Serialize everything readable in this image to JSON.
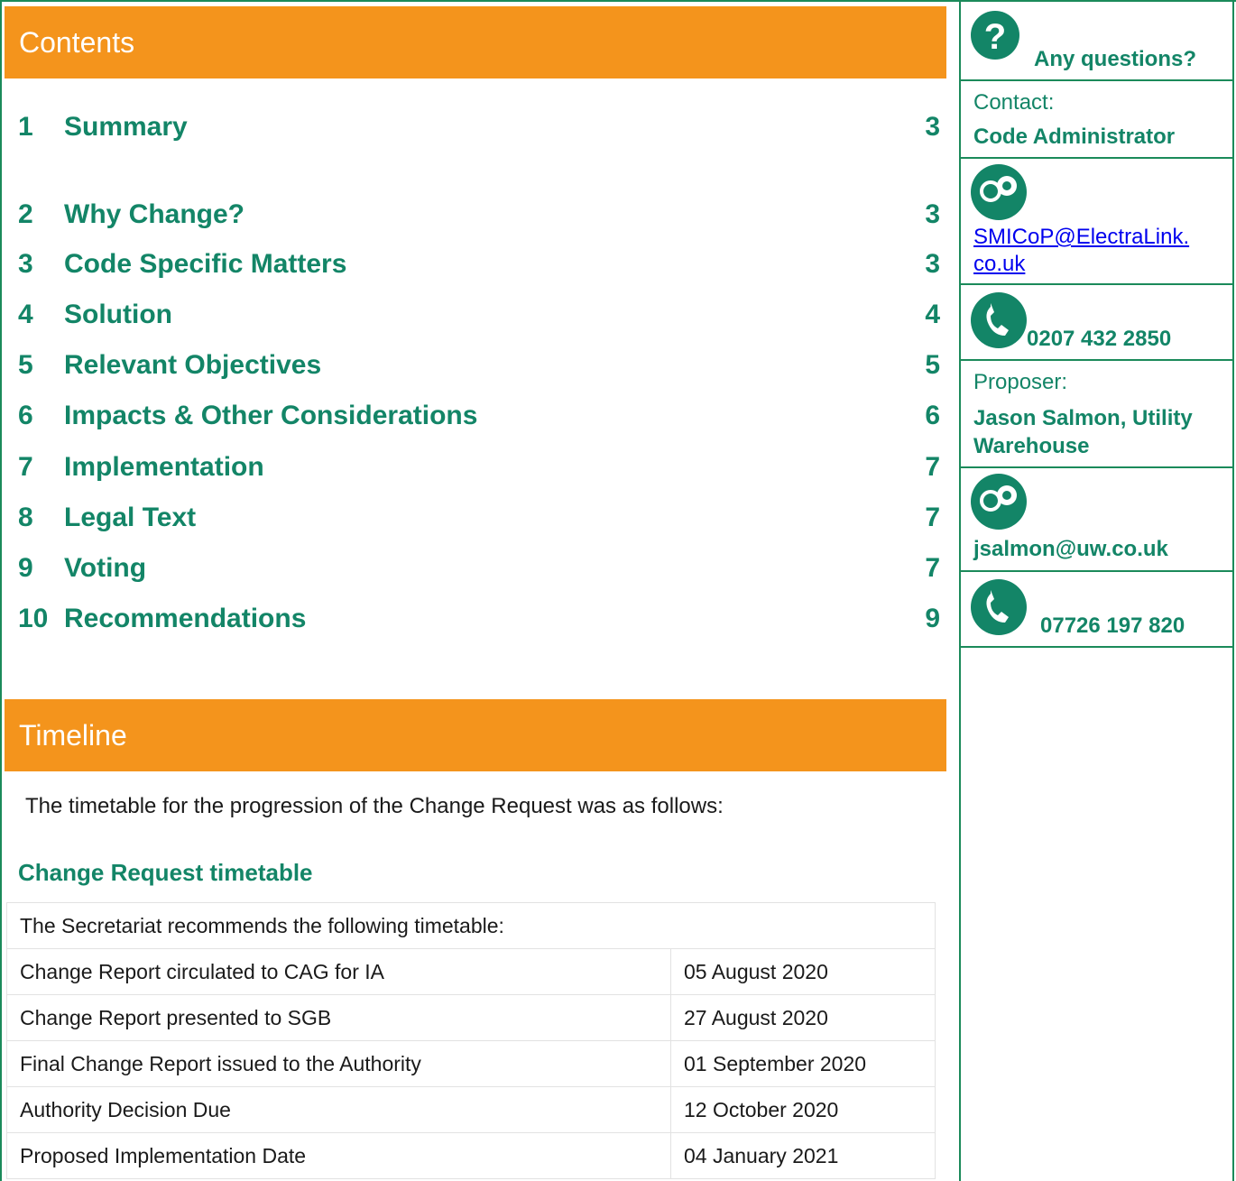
{
  "contents": {
    "title": "Contents",
    "items": [
      {
        "num": "1",
        "title": "Summary",
        "page": "3"
      },
      {
        "num": "2",
        "title": "Why Change?",
        "page": "3"
      },
      {
        "num": "3",
        "title": "Code Specific Matters",
        "page": "3"
      },
      {
        "num": "4",
        "title": "Solution",
        "page": "4"
      },
      {
        "num": "5",
        "title": "Relevant Objectives",
        "page": "5"
      },
      {
        "num": "6",
        "title": "Impacts & Other Considerations",
        "page": "6"
      },
      {
        "num": "7",
        "title": "Implementation",
        "page": "7"
      },
      {
        "num": "8",
        "title": "Legal Text",
        "page": "7"
      },
      {
        "num": "9",
        "title": "Voting",
        "page": "7"
      },
      {
        "num": "10",
        "title": "Recommendations",
        "page": "9"
      }
    ]
  },
  "timeline": {
    "title": "Timeline",
    "intro": "The timetable for the progression of the Change Request was as follows:",
    "subheading": "Change Request timetable",
    "table_header": "The Secretariat recommends the following timetable:",
    "rows": [
      {
        "event": "Change Report circulated to CAG for IA",
        "date": "05 August 2020"
      },
      {
        "event": "Change Report presented to SGB",
        "date": "27 August 2020"
      },
      {
        "event": "Final Change Report issued to the Authority",
        "date": "01 September 2020"
      },
      {
        "event": "Authority Decision Due",
        "date": "12 October 2020"
      },
      {
        "event": "Proposed Implementation Date",
        "date": "04 January 2021"
      }
    ]
  },
  "sidebar": {
    "questions": "Any questions?",
    "contact_label": "Contact:",
    "contact_name": "Code Administrator",
    "contact_email_line1": "SMICoP@ElectraLink.",
    "contact_email_line2": "co.uk",
    "contact_phone": "0207 432 2850",
    "proposer_label": "Proposer:",
    "proposer_name_line1": "Jason Salmon, Utility",
    "proposer_name_line2": "Warehouse",
    "proposer_email": "jsalmon@uw.co.uk",
    "proposer_phone": "07726 197 820",
    "icons": {
      "question": "question-icon",
      "email": "email-icon",
      "phone": "phone-icon"
    }
  }
}
